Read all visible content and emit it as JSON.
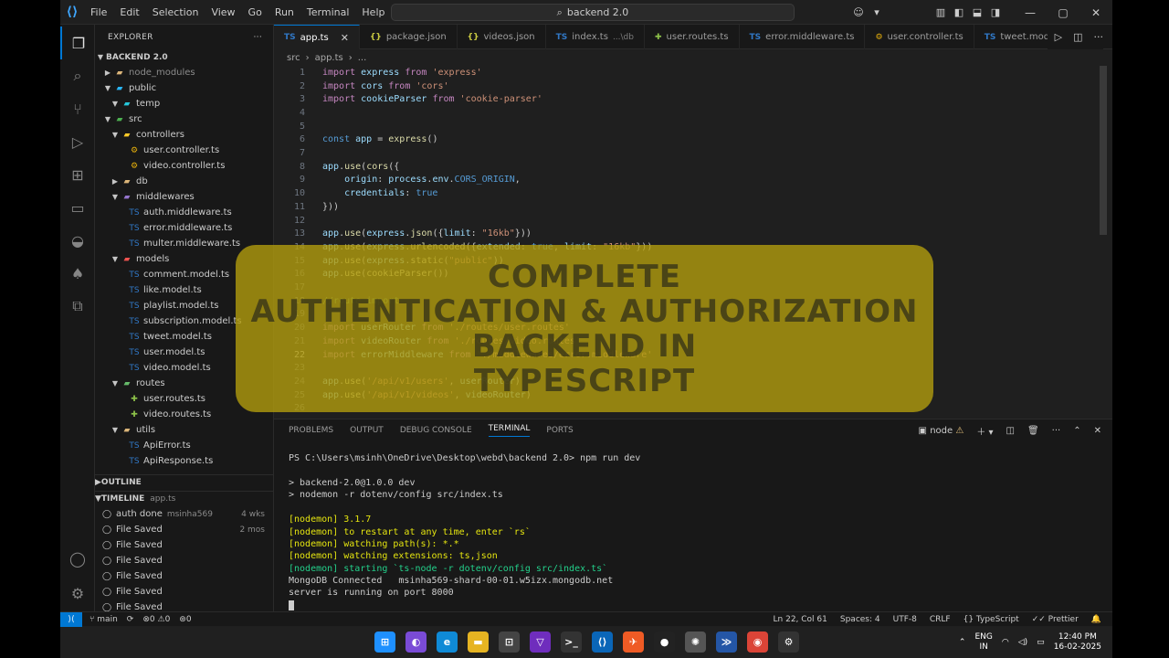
{
  "titlebar": {
    "menu": [
      "File",
      "Edit",
      "Selection",
      "View",
      "Go",
      "Run",
      "Terminal",
      "Help"
    ],
    "search_text": "backend 2.0"
  },
  "explorer": {
    "header": "EXPLORER",
    "project": "BACKEND 2.0",
    "tree": [
      {
        "label": "node_modules",
        "depth": 1,
        "kind": "folder",
        "open": false,
        "dim": true
      },
      {
        "label": "public",
        "depth": 1,
        "kind": "folder",
        "open": true
      },
      {
        "label": "temp",
        "depth": 2,
        "kind": "folder",
        "open": true
      },
      {
        "label": "src",
        "depth": 1,
        "kind": "folder",
        "open": true
      },
      {
        "label": "controllers",
        "depth": 2,
        "kind": "folder",
        "open": true
      },
      {
        "label": "user.controller.ts",
        "depth": 3,
        "kind": "ts-gear"
      },
      {
        "label": "video.controller.ts",
        "depth": 3,
        "kind": "ts-gear"
      },
      {
        "label": "db",
        "depth": 2,
        "kind": "folder",
        "open": false
      },
      {
        "label": "middlewares",
        "depth": 2,
        "kind": "folder",
        "open": true
      },
      {
        "label": "auth.middleware.ts",
        "depth": 3,
        "kind": "ts"
      },
      {
        "label": "error.middleware.ts",
        "depth": 3,
        "kind": "ts"
      },
      {
        "label": "multer.middleware.ts",
        "depth": 3,
        "kind": "ts"
      },
      {
        "label": "models",
        "depth": 2,
        "kind": "folder",
        "open": true
      },
      {
        "label": "comment.model.ts",
        "depth": 3,
        "kind": "ts"
      },
      {
        "label": "like.model.ts",
        "depth": 3,
        "kind": "ts"
      },
      {
        "label": "playlist.model.ts",
        "depth": 3,
        "kind": "ts"
      },
      {
        "label": "subscription.model.ts",
        "depth": 3,
        "kind": "ts"
      },
      {
        "label": "tweet.model.ts",
        "depth": 3,
        "kind": "ts"
      },
      {
        "label": "user.model.ts",
        "depth": 3,
        "kind": "ts"
      },
      {
        "label": "video.model.ts",
        "depth": 3,
        "kind": "ts"
      },
      {
        "label": "routes",
        "depth": 2,
        "kind": "folder",
        "open": true
      },
      {
        "label": "user.routes.ts",
        "depth": 3,
        "kind": "route"
      },
      {
        "label": "video.routes.ts",
        "depth": 3,
        "kind": "route"
      },
      {
        "label": "utils",
        "depth": 2,
        "kind": "folder",
        "open": true
      },
      {
        "label": "ApiError.ts",
        "depth": 3,
        "kind": "ts"
      },
      {
        "label": "ApiResponse.ts",
        "depth": 3,
        "kind": "ts"
      }
    ],
    "outline_label": "OUTLINE",
    "timeline_label": "TIMELINE",
    "timeline_file": "app.ts",
    "timeline": [
      {
        "label": "auth done",
        "author": "msinha569",
        "when": "4 wks"
      },
      {
        "label": "File Saved",
        "author": "",
        "when": "2 mos"
      },
      {
        "label": "File Saved",
        "author": "",
        "when": ""
      },
      {
        "label": "File Saved",
        "author": "",
        "when": ""
      },
      {
        "label": "File Saved",
        "author": "",
        "when": ""
      },
      {
        "label": "File Saved",
        "author": "",
        "when": ""
      },
      {
        "label": "File Saved",
        "author": "",
        "when": ""
      }
    ]
  },
  "tabs": [
    {
      "label": "app.ts",
      "icon": "TS",
      "color": "#3178c6",
      "active": true,
      "suffix": ""
    },
    {
      "label": "package.json",
      "icon": "{}",
      "color": "#cbcb41",
      "active": false,
      "suffix": ""
    },
    {
      "label": "videos.json",
      "icon": "{}",
      "color": "#cbcb41",
      "active": false,
      "suffix": ""
    },
    {
      "label": "index.ts",
      "icon": "TS",
      "color": "#3178c6",
      "active": false,
      "suffix": "...\\db"
    },
    {
      "label": "user.routes.ts",
      "icon": "✚",
      "color": "#8dc149",
      "active": false,
      "suffix": ""
    },
    {
      "label": "error.middleware.ts",
      "icon": "TS",
      "color": "#3178c6",
      "active": false,
      "suffix": ""
    },
    {
      "label": "user.controller.ts",
      "icon": "⚙",
      "color": "#e8b10b",
      "active": false,
      "suffix": ""
    },
    {
      "label": "tweet.model.ts",
      "icon": "TS",
      "color": "#3178c6",
      "active": false,
      "suffix": ""
    }
  ],
  "breadcrumb": [
    "src",
    "app.ts",
    "..."
  ],
  "code": [
    {
      "n": 1,
      "t": [
        [
          "k",
          "import "
        ],
        [
          "v",
          "express "
        ],
        [
          "k",
          "from "
        ],
        [
          "s",
          "'express'"
        ]
      ]
    },
    {
      "n": 2,
      "t": [
        [
          "k",
          "import "
        ],
        [
          "v",
          "cors "
        ],
        [
          "k",
          "from "
        ],
        [
          "s",
          "'cors'"
        ]
      ]
    },
    {
      "n": 3,
      "t": [
        [
          "k",
          "import "
        ],
        [
          "v",
          "cookieParser "
        ],
        [
          "k",
          "from "
        ],
        [
          "s",
          "'cookie-parser'"
        ]
      ]
    },
    {
      "n": 4,
      "t": []
    },
    {
      "n": 5,
      "t": []
    },
    {
      "n": 6,
      "t": [
        [
          "kb",
          "const "
        ],
        [
          "v",
          "app "
        ],
        [
          "p",
          "= "
        ],
        [
          "f",
          "express"
        ],
        [
          "p",
          "()"
        ]
      ]
    },
    {
      "n": 7,
      "t": []
    },
    {
      "n": 8,
      "t": [
        [
          "v",
          "app"
        ],
        [
          "p",
          "."
        ],
        [
          "f",
          "use"
        ],
        [
          "p",
          "("
        ],
        [
          "f",
          "cors"
        ],
        [
          "p",
          "({"
        ]
      ]
    },
    {
      "n": 9,
      "t": [
        [
          "p",
          "    "
        ],
        [
          "v",
          "origin"
        ],
        [
          "p",
          ": "
        ],
        [
          "v",
          "process"
        ],
        [
          "p",
          "."
        ],
        [
          "v",
          "env"
        ],
        [
          "p",
          "."
        ],
        [
          "kb",
          "CORS_ORIGIN"
        ],
        [
          "p",
          ","
        ]
      ]
    },
    {
      "n": 10,
      "t": [
        [
          "p",
          "    "
        ],
        [
          "v",
          "credentials"
        ],
        [
          "p",
          ": "
        ],
        [
          "kb",
          "true"
        ]
      ]
    },
    {
      "n": 11,
      "t": [
        [
          "p",
          "}))"
        ]
      ]
    },
    {
      "n": 12,
      "t": []
    },
    {
      "n": 13,
      "t": [
        [
          "v",
          "app"
        ],
        [
          "p",
          "."
        ],
        [
          "f",
          "use"
        ],
        [
          "p",
          "("
        ],
        [
          "v",
          "express"
        ],
        [
          "p",
          "."
        ],
        [
          "f",
          "json"
        ],
        [
          "p",
          "({"
        ],
        [
          "v",
          "limit"
        ],
        [
          "p",
          ": "
        ],
        [
          "s",
          "\"16kb\""
        ],
        [
          "p",
          "}))"
        ]
      ]
    },
    {
      "n": 14,
      "t": [
        [
          "v",
          "app"
        ],
        [
          "p",
          "."
        ],
        [
          "f",
          "use"
        ],
        [
          "p",
          "("
        ],
        [
          "v",
          "express"
        ],
        [
          "p",
          "."
        ],
        [
          "f",
          "urlencoded"
        ],
        [
          "p",
          "({"
        ],
        [
          "v",
          "extended"
        ],
        [
          "p",
          ": "
        ],
        [
          "kb",
          "true"
        ],
        [
          "p",
          ", "
        ],
        [
          "v",
          "limit"
        ],
        [
          "p",
          ": "
        ],
        [
          "s",
          "\"16kb\""
        ],
        [
          "p",
          "}))"
        ]
      ]
    },
    {
      "n": 15,
      "t": [
        [
          "v",
          "app"
        ],
        [
          "p",
          "."
        ],
        [
          "f",
          "use"
        ],
        [
          "p",
          "("
        ],
        [
          "v",
          "express"
        ],
        [
          "p",
          "."
        ],
        [
          "f",
          "static"
        ],
        [
          "p",
          "("
        ],
        [
          "s",
          "\"public\""
        ],
        [
          "p",
          "))"
        ]
      ]
    },
    {
      "n": 16,
      "t": [
        [
          "v",
          "app"
        ],
        [
          "p",
          "."
        ],
        [
          "f",
          "use"
        ],
        [
          "p",
          "("
        ],
        [
          "f",
          "cookieParser"
        ],
        [
          "p",
          "())"
        ]
      ]
    },
    {
      "n": 17,
      "t": []
    },
    {
      "n": 18,
      "t": [
        [
          "c",
          "//route import"
        ]
      ]
    },
    {
      "n": 19,
      "t": []
    },
    {
      "n": 20,
      "t": [
        [
          "k",
          "import "
        ],
        [
          "v",
          "userRouter "
        ],
        [
          "k",
          "from "
        ],
        [
          "s",
          "'./routes/user.routes'"
        ]
      ]
    },
    {
      "n": 21,
      "t": [
        [
          "k",
          "import "
        ],
        [
          "v",
          "videoRouter "
        ],
        [
          "k",
          "from "
        ],
        [
          "s",
          "'./routes/video.routes'"
        ]
      ]
    },
    {
      "n": 22,
      "t": [
        [
          "k",
          "import "
        ],
        [
          "v",
          "errorMiddleware "
        ],
        [
          "k",
          "from "
        ],
        [
          "s",
          "'./middlewares/error.middleware'"
        ]
      ]
    },
    {
      "n": 23,
      "t": []
    },
    {
      "n": 24,
      "t": [
        [
          "v",
          "app"
        ],
        [
          "p",
          "."
        ],
        [
          "f",
          "use"
        ],
        [
          "p",
          "("
        ],
        [
          "s",
          "'/api/v1/users'"
        ],
        [
          "p",
          ", "
        ],
        [
          "v",
          "userRouter"
        ],
        [
          "p",
          ")"
        ]
      ]
    },
    {
      "n": 25,
      "t": [
        [
          "v",
          "app"
        ],
        [
          "p",
          "."
        ],
        [
          "f",
          "use"
        ],
        [
          "p",
          "("
        ],
        [
          "s",
          "'/api/v1/videos'"
        ],
        [
          "p",
          ", "
        ],
        [
          "v",
          "videoRouter"
        ],
        [
          "p",
          ")"
        ]
      ]
    },
    {
      "n": 26,
      "t": []
    }
  ],
  "current_line": 22,
  "banner": {
    "line1": "COMPLETE",
    "line2": "AUTHENTICATION & AUTHORIZATION",
    "line3": "BACKEND IN",
    "line4": "TYPESCRIPT"
  },
  "panel": {
    "tabs": [
      "PROBLEMS",
      "OUTPUT",
      "DEBUG CONSOLE",
      "TERMINAL",
      "PORTS"
    ],
    "active_tab": "TERMINAL",
    "terminal_label": "node",
    "lines": [
      {
        "text": "PS C:\\Users\\msinh\\OneDrive\\Desktop\\webd\\backend 2.0> npm run dev",
        "style": "w"
      },
      {
        "text": "",
        "style": "w"
      },
      {
        "text": "> backend-2.0@1.0.0 dev",
        "style": "w"
      },
      {
        "text": "> nodemon -r dotenv/config src/index.ts",
        "style": "w"
      },
      {
        "text": "",
        "style": "w"
      },
      {
        "text": "[nodemon] 3.1.7",
        "style": "y"
      },
      {
        "text": "[nodemon] to restart at any time, enter `rs`",
        "style": "y"
      },
      {
        "text": "[nodemon] watching path(s): *.*",
        "style": "y"
      },
      {
        "text": "[nodemon] watching extensions: ts,json",
        "style": "y"
      },
      {
        "text": "[nodemon] starting `ts-node -r dotenv/config src/index.ts`",
        "style": "g"
      },
      {
        "text": "MongoDB Connected   msinha569-shard-00-01.w5izx.mongodb.net",
        "style": "w"
      },
      {
        "text": "server is running on port 8000",
        "style": "w"
      }
    ]
  },
  "status": {
    "branch": "main",
    "errors": "0",
    "warnings": "0",
    "ports": "0",
    "position": "Ln 22, Col 61",
    "spaces": "Spaces: 4",
    "encoding": "UTF-8",
    "eol": "CRLF",
    "language": "TypeScript",
    "formatter": "Prettier"
  },
  "taskbar": {
    "apps": [
      {
        "name": "windows-start",
        "glyph": "⊞",
        "bg": "#1e90ff"
      },
      {
        "name": "copilot",
        "glyph": "◐",
        "bg": "#7a4bd6"
      },
      {
        "name": "edge",
        "glyph": "e",
        "bg": "#0f8ad6"
      },
      {
        "name": "file-explorer",
        "glyph": "▬",
        "bg": "#e6b422"
      },
      {
        "name": "app-grid",
        "glyph": "⊡",
        "bg": "#444444"
      },
      {
        "name": "vpn",
        "glyph": "▽",
        "bg": "#6f2dbd"
      },
      {
        "name": "terminal",
        "glyph": ">_",
        "bg": "#333333"
      },
      {
        "name": "vscode",
        "glyph": "⟨⟩",
        "bg": "#0a66b8"
      },
      {
        "name": "postman",
        "glyph": "✈",
        "bg": "#ef5b25"
      },
      {
        "name": "github-desktop",
        "glyph": "●",
        "bg": "#222222"
      },
      {
        "name": "chatgpt",
        "glyph": "✺",
        "bg": "#555555"
      },
      {
        "name": "powershell",
        "glyph": "≫",
        "bg": "#2456a6"
      },
      {
        "name": "chrome",
        "glyph": "◉",
        "bg": "#db4437"
      },
      {
        "name": "settings",
        "glyph": "⚙",
        "bg": "#333333"
      }
    ],
    "lang_top": "ENG",
    "lang_bottom": "IN",
    "time": "12:40 PM",
    "date": "16-02-2025"
  },
  "colors": {
    "accent": "#0078d4",
    "editor_bg": "#1f1f1f",
    "sidebar_bg": "#181818",
    "banner": "#b29c0e"
  }
}
